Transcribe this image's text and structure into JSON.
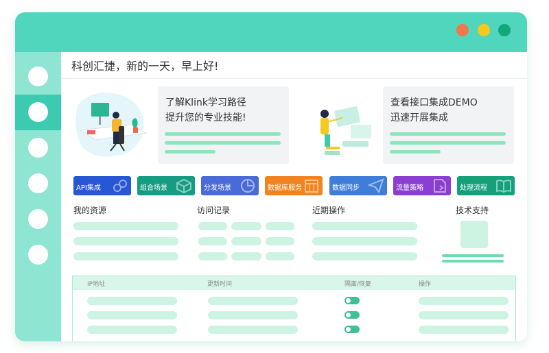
{
  "greeting": "科创汇捷，新的一天，早上好!",
  "window_dots": [
    "#f2774b",
    "#f5c91d",
    "#13a879"
  ],
  "sidebar": {
    "items": 6,
    "active_index": 0
  },
  "cards": [
    {
      "line1": "了解Klink学习路径",
      "line2": "提升您的专业技能!"
    },
    {
      "line1": "查看接口集成DEMO",
      "line2": "迅速开展集成"
    }
  ],
  "tiles": [
    {
      "label": "API集成",
      "icon": "link-icon",
      "color": "#2857d6"
    },
    {
      "label": "组合场景",
      "icon": "cube-icon",
      "color": "#169c83"
    },
    {
      "label": "分发场景",
      "icon": "pie-chart-icon",
      "color": "#4a6bd7"
    },
    {
      "label": "数据库服务",
      "icon": "calendar-icon",
      "color": "#f1841f"
    },
    {
      "label": "数据同步",
      "icon": "send-icon",
      "color": "#3f7ed8"
    },
    {
      "label": "流量策略",
      "icon": "document-icon",
      "color": "#8a3fd2"
    },
    {
      "label": "处理流程",
      "icon": "book-icon",
      "color": "#15a07a"
    }
  ],
  "sections": {
    "resources": "我的资源",
    "visits": "访问记录",
    "operations": "近期操作",
    "support": "技术支持"
  },
  "table": {
    "headers": [
      "IP地址",
      "更新时间",
      "隔离/恢复",
      "操作"
    ],
    "row_count": 3
  }
}
